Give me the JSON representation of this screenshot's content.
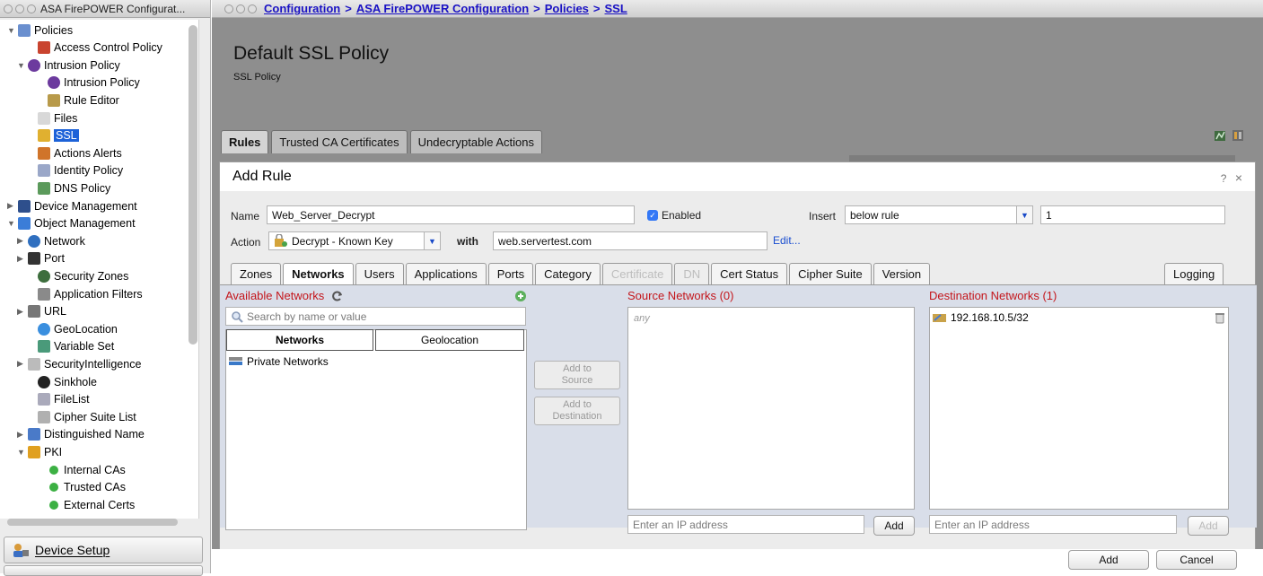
{
  "left_window": {
    "title": "ASA FirePOWER Configurat...",
    "tree": [
      {
        "label": "Policies",
        "icon": "policies-icon",
        "arrow": "▼",
        "indent": 0
      },
      {
        "label": "Access Control Policy",
        "icon": "access-control-icon",
        "arrow": "",
        "indent": 2
      },
      {
        "label": "Intrusion Policy",
        "icon": "intrusion-icon",
        "arrow": "▼",
        "indent": 1
      },
      {
        "label": "Intrusion Policy",
        "icon": "intrusion-icon",
        "arrow": "",
        "indent": 3
      },
      {
        "label": "Rule Editor",
        "icon": "rule-editor-icon",
        "arrow": "",
        "indent": 3
      },
      {
        "label": "Files",
        "icon": "file-icon",
        "arrow": "",
        "indent": 2
      },
      {
        "label": "SSL",
        "icon": "lock-icon",
        "arrow": "",
        "indent": 2,
        "selected": true
      },
      {
        "label": "Actions Alerts",
        "icon": "alert-icon",
        "arrow": "",
        "indent": 2
      },
      {
        "label": "Identity Policy",
        "icon": "identity-icon",
        "arrow": "",
        "indent": 2
      },
      {
        "label": "DNS Policy",
        "icon": "dns-icon",
        "arrow": "",
        "indent": 2
      },
      {
        "label": "Device Management",
        "icon": "device-icon",
        "arrow": "▶",
        "indent": 0
      },
      {
        "label": "Object Management",
        "icon": "object-icon",
        "arrow": "▼",
        "indent": 0
      },
      {
        "label": "Network",
        "icon": "globe-icon",
        "arrow": "▶",
        "indent": 1
      },
      {
        "label": "Port",
        "icon": "port-icon",
        "arrow": "▶",
        "indent": 1
      },
      {
        "label": "Security Zones",
        "icon": "zones-icon",
        "arrow": "",
        "indent": 2
      },
      {
        "label": "Application Filters",
        "icon": "filter-icon",
        "arrow": "",
        "indent": 2
      },
      {
        "label": "URL",
        "icon": "url-icon",
        "arrow": "▶",
        "indent": 1
      },
      {
        "label": "GeoLocation",
        "icon": "geo-icon",
        "arrow": "",
        "indent": 2
      },
      {
        "label": "Variable Set",
        "icon": "variable-icon",
        "arrow": "",
        "indent": 2
      },
      {
        "label": "SecurityIntelligence",
        "icon": "bulb-icon",
        "arrow": "▶",
        "indent": 1
      },
      {
        "label": "Sinkhole",
        "icon": "sinkhole-icon",
        "arrow": "",
        "indent": 2
      },
      {
        "label": "FileList",
        "icon": "filelist-icon",
        "arrow": "",
        "indent": 2
      },
      {
        "label": "Cipher Suite List",
        "icon": "cipher-icon",
        "arrow": "",
        "indent": 2
      },
      {
        "label": "Distinguished Name",
        "icon": "dn-icon",
        "arrow": "▶",
        "indent": 1
      },
      {
        "label": "PKI",
        "icon": "key-icon",
        "arrow": "▼",
        "indent": 1
      },
      {
        "label": "Internal CAs",
        "icon": "green-dot-icon",
        "arrow": "",
        "indent": 3
      },
      {
        "label": "Trusted CAs",
        "icon": "green-dot-icon",
        "arrow": "",
        "indent": 3
      },
      {
        "label": "External Certs",
        "icon": "green-dot-icon",
        "arrow": "",
        "indent": 3
      }
    ],
    "device_setup": "Device Setup"
  },
  "right_window": {
    "breadcrumb": [
      "Configuration",
      "ASA FirePOWER Configuration",
      "Policies",
      "SSL"
    ],
    "sep": ">",
    "policy_title": "Default SSL Policy",
    "policy_subtitle": "SSL Policy",
    "main_tabs": [
      "Rules",
      "Trusted CA Certificates",
      "Undecryptable Actions"
    ]
  },
  "dialog": {
    "title": "Add Rule",
    "help": "?",
    "close": "×",
    "name_label": "Name",
    "name_value": "Web_Server_Decrypt",
    "enabled_label": "Enabled",
    "insert_label": "Insert",
    "insert_value": "below rule",
    "insert_number": "1",
    "action_label": "Action",
    "action_value": "Decrypt - Known Key",
    "with_label": "with",
    "with_value": "web.servertest.com",
    "edit_link": "Edit...",
    "tabs": [
      {
        "label": "Zones",
        "state": ""
      },
      {
        "label": "Networks",
        "state": "act"
      },
      {
        "label": "Users",
        "state": ""
      },
      {
        "label": "Applications",
        "state": ""
      },
      {
        "label": "Ports",
        "state": ""
      },
      {
        "label": "Category",
        "state": ""
      },
      {
        "label": "Certificate",
        "state": "dis"
      },
      {
        "label": "DN",
        "state": "dis"
      },
      {
        "label": "Cert Status",
        "state": ""
      },
      {
        "label": "Cipher Suite",
        "state": ""
      },
      {
        "label": "Version",
        "state": ""
      }
    ],
    "logging_tab": "Logging",
    "available": {
      "heading": "Available Networks",
      "search_placeholder": "Search by name or value",
      "subtab_networks": "Networks",
      "subtab_geolocation": "Geolocation",
      "items": [
        "Private Networks"
      ]
    },
    "add_to_source": "Add to\nSource",
    "add_to_destination": "Add to\nDestination",
    "source": {
      "heading": "Source Networks (0)",
      "placeholder_item": "any",
      "ip_placeholder": "Enter an IP address",
      "add_button": "Add"
    },
    "destination": {
      "heading": "Destination Networks (1)",
      "items": [
        "192.168.10.5/32"
      ],
      "ip_placeholder": "Enter an IP address",
      "add_button": "Add"
    },
    "footer_add": "Add",
    "footer_cancel": "Cancel"
  }
}
